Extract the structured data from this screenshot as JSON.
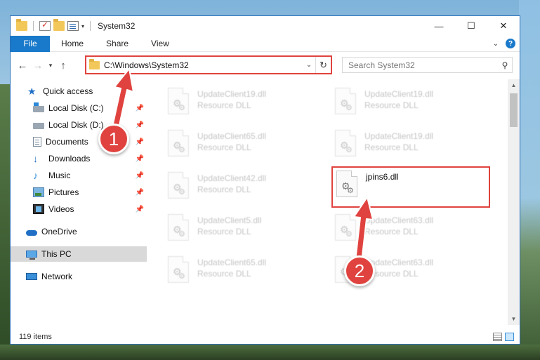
{
  "window": {
    "title": "System32",
    "controls": {
      "minimize": "—",
      "maximize": "☐",
      "close": "✕"
    }
  },
  "ribbon": {
    "file": "File",
    "tabs": [
      "Home",
      "Share",
      "View"
    ]
  },
  "nav": {
    "address": "C:\\Windows\\System32",
    "search_placeholder": "Search System32"
  },
  "sidebar": {
    "items": [
      {
        "label": "Quick access",
        "icon": "star-icon",
        "pinned": false
      },
      {
        "label": "Local Disk (C:)",
        "icon": "drive-icon",
        "pinned": true
      },
      {
        "label": "Local Disk (D:)",
        "icon": "drive-icon",
        "pinned": true
      },
      {
        "label": "Documents",
        "icon": "documents-icon",
        "pinned": true
      },
      {
        "label": "Downloads",
        "icon": "downloads-icon",
        "pinned": true
      },
      {
        "label": "Music",
        "icon": "music-icon",
        "pinned": true
      },
      {
        "label": "Pictures",
        "icon": "pictures-icon",
        "pinned": true
      },
      {
        "label": "Videos",
        "icon": "videos-icon",
        "pinned": true
      },
      {
        "label": "OneDrive",
        "icon": "onedrive-icon",
        "pinned": false
      },
      {
        "label": "This PC",
        "icon": "this-pc-icon",
        "pinned": false,
        "selected": true
      },
      {
        "label": "Network",
        "icon": "network-icon",
        "pinned": false
      }
    ]
  },
  "files": [
    {
      "name": "UpdateClient19.dll",
      "type": "Resource DLL",
      "blurred": true
    },
    {
      "name": "UpdateClient19.dll",
      "type": "Resource DLL",
      "blurred": true
    },
    {
      "name": "UpdateClient65.dll",
      "type": "Resource DLL",
      "blurred": true
    },
    {
      "name": "UpdateClient19.dll",
      "type": "Resource DLL",
      "blurred": true
    },
    {
      "name": "UpdateClient42.dll",
      "type": "Resource DLL",
      "blurred": true
    },
    {
      "name": "jpins6.dll",
      "type": "",
      "blurred": false,
      "highlighted": true
    },
    {
      "name": "UpdateClient5.dll",
      "type": "Resource DLL",
      "blurred": true
    },
    {
      "name": "UpdateClient63.dll",
      "type": "Resource DLL",
      "blurred": true
    },
    {
      "name": "UpdateClient65.dll",
      "type": "Resource DLL",
      "blurred": true
    },
    {
      "name": "UpdateClient63.dll",
      "type": "Resource DLL",
      "blurred": true
    }
  ],
  "status": {
    "item_count": "119 items"
  },
  "annotations": {
    "step1": "1",
    "step2": "2",
    "color": "#e0433f"
  },
  "colors": {
    "accent": "#1979ca",
    "selection": "#cce8ff",
    "annotation": "#e0433f"
  }
}
